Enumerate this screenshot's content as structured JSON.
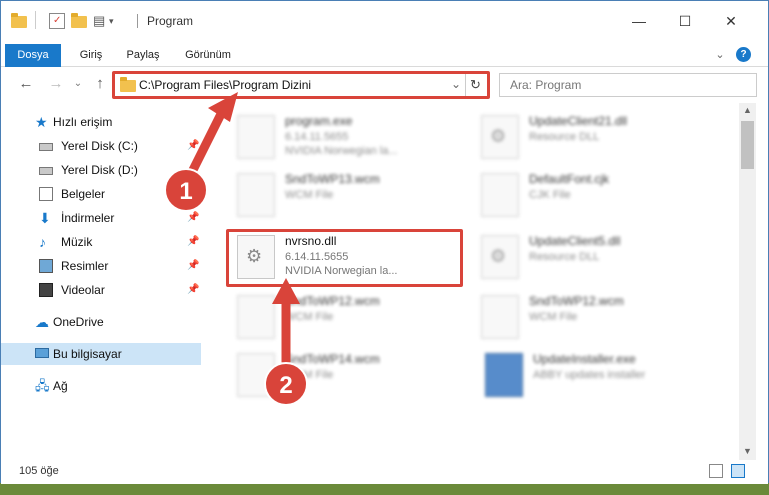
{
  "window": {
    "title": "Program",
    "controls": {
      "minimize": "—",
      "maximize": "☐",
      "close": "✕"
    }
  },
  "ribbon": {
    "tabs": [
      "Dosya",
      "Giriş",
      "Paylaş",
      "Görünüm"
    ],
    "expand_icon": "⌄",
    "help_icon": "?"
  },
  "nav": {
    "back": "←",
    "forward": "→",
    "history": "⌄",
    "up": "↑",
    "address": "C:\\Program Files\\Program Dizini",
    "address_dropdown": "⌄",
    "refresh": "↻",
    "search_placeholder": "Ara: Program"
  },
  "sidebar": {
    "quick_access": "Hızlı erişim",
    "items": [
      {
        "label": "Yerel Disk (C:)",
        "icon": "drive-icon",
        "pinned": true
      },
      {
        "label": "Yerel Disk (D:)",
        "icon": "drive-icon",
        "pinned": false
      },
      {
        "label": "Belgeler",
        "icon": "documents-icon",
        "pinned": true
      },
      {
        "label": "İndirmeler",
        "icon": "download-icon",
        "pinned": true
      },
      {
        "label": "Müzik",
        "icon": "music-icon",
        "pinned": true
      },
      {
        "label": "Resimler",
        "icon": "pictures-icon",
        "pinned": true
      },
      {
        "label": "Videolar",
        "icon": "video-icon",
        "pinned": true
      }
    ],
    "onedrive": "OneDrive",
    "this_pc": "Bu bilgisayar",
    "network": "Ağ",
    "pin_glyph": "📌"
  },
  "files": [
    {
      "name": "program.exe",
      "line2": "6.14.11.5655",
      "line3": "NVIDIA Norwegian la...",
      "type": "exe",
      "blurred": true
    },
    {
      "name": "UpdateClient21.dll",
      "line2": "Resource DLL",
      "line3": "",
      "type": "dll",
      "blurred": true
    },
    {
      "name": "SndToWP13.wcm",
      "line2": "WCM File",
      "line3": "",
      "type": "file",
      "blurred": true
    },
    {
      "name": "DefaultFont.cjk",
      "line2": "CJK File",
      "line3": "",
      "type": "file",
      "blurred": true
    },
    {
      "name": "nvrsno.dll",
      "line2": "6.14.11.5655",
      "line3": "NVIDIA Norwegian la...",
      "type": "dll",
      "blurred": false
    },
    {
      "name": "UpdateClient5.dll",
      "line2": "Resource DLL",
      "line3": "",
      "type": "dll",
      "blurred": true
    },
    {
      "name": "SndToWP12.wcm",
      "line2": "WCM File",
      "line3": "",
      "type": "file",
      "blurred": true
    },
    {
      "name": "SndToWP12.wcm",
      "line2": "WCM File",
      "line3": "",
      "type": "file",
      "blurred": true
    },
    {
      "name": "SndToWP14.wcm",
      "line2": "WCM File",
      "line3": "",
      "type": "file",
      "blurred": true
    },
    {
      "name": "UpdateInstaller.exe",
      "line2": "ABBY updates installer",
      "line3": "",
      "type": "exe",
      "blurred": true
    }
  ],
  "status": {
    "count": "105 öğe"
  },
  "annotations": {
    "step1": "1",
    "step2": "2"
  },
  "colors": {
    "accent": "#1979ca",
    "highlight": "#d9443a",
    "selected": "#cce4f7"
  }
}
